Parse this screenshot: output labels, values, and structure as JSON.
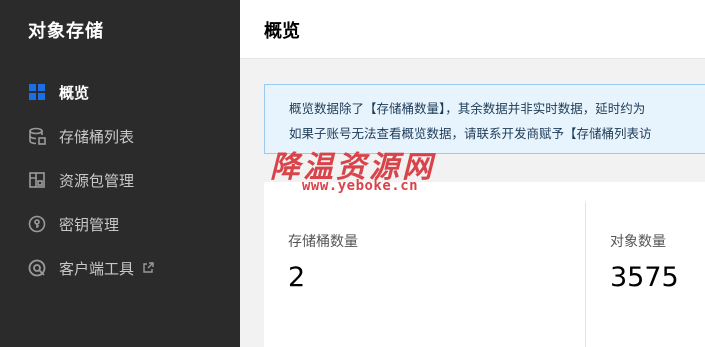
{
  "app": {
    "title": "对象存储"
  },
  "sidebar": {
    "items": [
      {
        "label": "概览",
        "icon": "grid-icon",
        "active": true
      },
      {
        "label": "存储桶列表",
        "icon": "database-icon",
        "active": false
      },
      {
        "label": "资源包管理",
        "icon": "package-icon",
        "active": false
      },
      {
        "label": "密钥管理",
        "icon": "key-icon",
        "active": false
      },
      {
        "label": "客户端工具",
        "icon": "client-tool-icon",
        "external_icon": "external-link-icon",
        "active": false
      }
    ]
  },
  "header": {
    "title": "概览"
  },
  "notice": {
    "line1": "概览数据除了【存储桶数量】，其余数据并非实时数据，延时约为",
    "line2": "如果子账号无法查看概览数据，请联系开发商赋予【存储桶列表访"
  },
  "watermark": {
    "text": "降温资源网",
    "url": "www.yeboke.cn"
  },
  "stats": [
    {
      "label": "存储桶数量",
      "value": "2"
    },
    {
      "label": "对象数量",
      "value": "3575"
    }
  ],
  "colors": {
    "sidebar_bg": "#2b2b2b",
    "accent": "#1a6fe8",
    "notice_bg": "#e8f4fd",
    "watermark": "#d9444a"
  }
}
